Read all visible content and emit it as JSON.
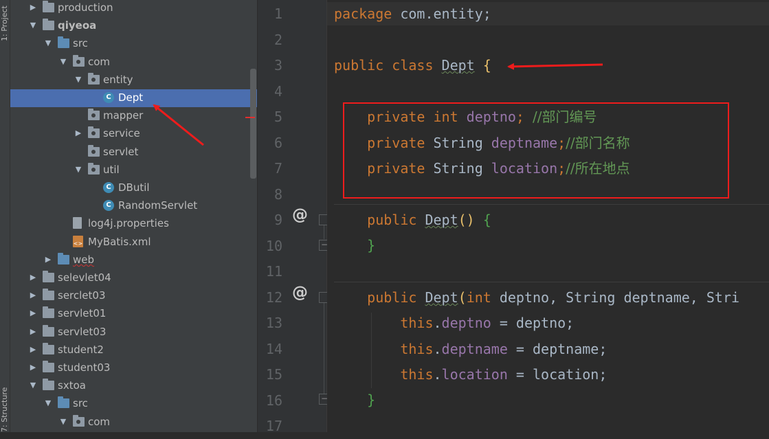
{
  "toolwindows": {
    "project_tab": "1: Project",
    "structure_tab": "7: Structure"
  },
  "tree": [
    {
      "label": "production",
      "icon": "folder-icon",
      "indent": 0,
      "arrow": "right"
    },
    {
      "label": "qiyeoa",
      "icon": "module-folder-icon",
      "indent": 0,
      "arrow": "down",
      "bold": true
    },
    {
      "label": "src",
      "icon": "source-folder-icon",
      "indent": 1,
      "arrow": "down"
    },
    {
      "label": "com",
      "icon": "package-icon",
      "indent": 2,
      "arrow": "down"
    },
    {
      "label": "entity",
      "icon": "package-icon",
      "indent": 3,
      "arrow": "down"
    },
    {
      "label": "Dept",
      "icon": "class-icon",
      "indent": 4,
      "arrow": "",
      "selected": true
    },
    {
      "label": "mapper",
      "icon": "package-icon",
      "indent": 3,
      "arrow": ""
    },
    {
      "label": "service",
      "icon": "package-icon",
      "indent": 3,
      "arrow": "right"
    },
    {
      "label": "servlet",
      "icon": "package-icon",
      "indent": 3,
      "arrow": ""
    },
    {
      "label": "util",
      "icon": "package-icon",
      "indent": 3,
      "arrow": "down"
    },
    {
      "label": "DButil",
      "icon": "class-icon",
      "indent": 4,
      "arrow": ""
    },
    {
      "label": "RandomServlet",
      "icon": "class-icon",
      "indent": 4,
      "arrow": ""
    },
    {
      "label": "log4j.properties",
      "icon": "properties-file-icon",
      "indent": 2,
      "arrow": ""
    },
    {
      "label": "MyBatis.xml",
      "icon": "xml-file-icon",
      "indent": 2,
      "arrow": ""
    },
    {
      "label": "web",
      "icon": "web-folder-icon",
      "indent": 1,
      "arrow": "right",
      "wavy": true
    },
    {
      "label": "selevlet04",
      "icon": "folder-icon",
      "indent": 0,
      "arrow": "right"
    },
    {
      "label": "serclet03",
      "icon": "folder-icon",
      "indent": 0,
      "arrow": "right"
    },
    {
      "label": "servlet01",
      "icon": "folder-icon",
      "indent": 0,
      "arrow": "right"
    },
    {
      "label": "servlet03",
      "icon": "folder-icon",
      "indent": 0,
      "arrow": "right"
    },
    {
      "label": "student2",
      "icon": "folder-icon",
      "indent": 0,
      "arrow": "right"
    },
    {
      "label": "student03",
      "icon": "folder-icon",
      "indent": 0,
      "arrow": "right"
    },
    {
      "label": "sxtoa",
      "icon": "folder-icon",
      "indent": 0,
      "arrow": "down"
    },
    {
      "label": "src",
      "icon": "source-folder-icon",
      "indent": 1,
      "arrow": "down"
    },
    {
      "label": "com",
      "icon": "package-icon",
      "indent": 2,
      "arrow": "down"
    }
  ],
  "editor": {
    "line_numbers": [
      "1",
      "2",
      "3",
      "4",
      "5",
      "6",
      "7",
      "8",
      "9",
      "10",
      "11",
      "12",
      "13",
      "14",
      "15",
      "16",
      "17"
    ],
    "gutter_marker": "@",
    "code": {
      "l1_kw": "package",
      "l1_rest": " com.entity;",
      "l3_kw": "public class ",
      "l3_name": "Dept",
      "l3_brace": " {",
      "l5_kw": "private int ",
      "l5_fld": "deptno",
      "l5_semi": "; ",
      "l5_cmt": "//部门编号",
      "l6_kw": "private ",
      "l6_type": "String ",
      "l6_fld": "deptname",
      "l6_semi": ";",
      "l6_cmt": "//部门名称",
      "l7_kw": "private ",
      "l7_type": "String ",
      "l7_fld": "location",
      "l7_semi": ";",
      "l7_cmt": "//所在地点",
      "l9_kw": "public ",
      "l9_name": "Dept",
      "l9_paren": "()",
      "l9_brace": " {",
      "l10_brace": "}",
      "l12_kw": "public ",
      "l12_name": "Dept",
      "l12_open": "(",
      "l12_int": "int",
      "l12_rest": " deptno, String deptname, Stri",
      "l13_this": "this",
      "l13_dot": ".",
      "l13_fld": "deptno",
      "l13_rest": " = deptno;",
      "l14_this": "this",
      "l14_dot": ".",
      "l14_fld": "deptname",
      "l14_rest": " = deptname;",
      "l15_this": "this",
      "l15_dot": ".",
      "l15_fld": "location",
      "l15_rest": " = location;",
      "l16_brace": "}"
    }
  },
  "annotation_color": "#ee1c1c"
}
